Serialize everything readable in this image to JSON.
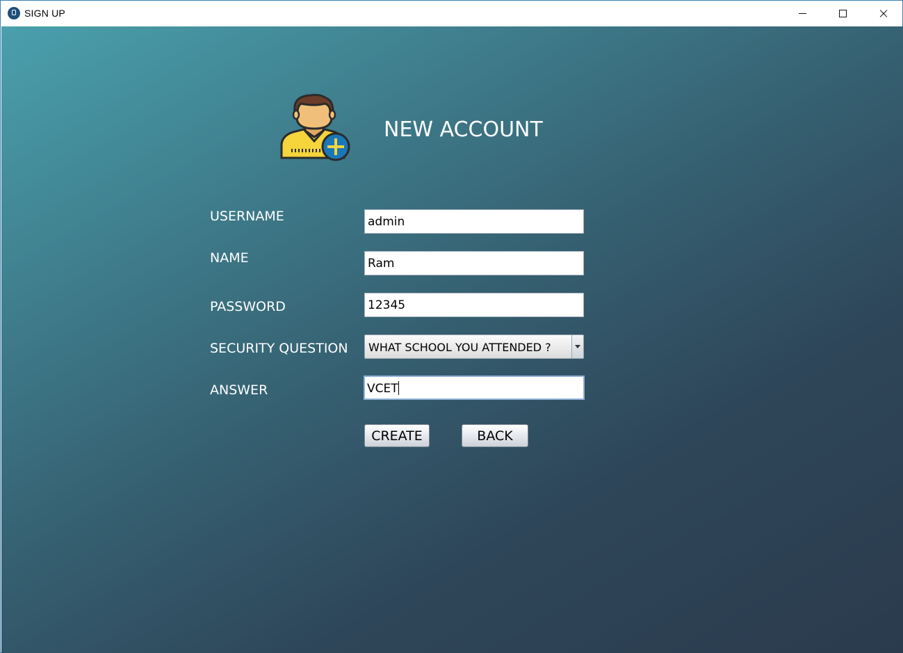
{
  "window": {
    "title": "SIGN UP",
    "controls": [
      "minimize-icon",
      "maximize-icon",
      "close-icon"
    ]
  },
  "header": {
    "title": "NEW ACCOUNT",
    "icon": "add-user-icon"
  },
  "form": {
    "username": {
      "label": "USERNAME",
      "value": "admin"
    },
    "name": {
      "label": "NAME",
      "value": "Ram"
    },
    "password": {
      "label": "PASSWORD",
      "value": "12345"
    },
    "security_question": {
      "label": "SECURITY QUESTION",
      "selected": "WHAT SCHOOL YOU ATTENDED ?"
    },
    "answer": {
      "label": "ANSWER",
      "value": "VCET"
    }
  },
  "buttons": {
    "create": "CREATE",
    "back": "BACK"
  },
  "colors": {
    "gradient_start": "#4aa0ad",
    "gradient_end": "#2b3b4d",
    "avatar_shirt": "#f5d43c",
    "avatar_skin": "#f0c07a",
    "plus_badge": "#1a78b8"
  }
}
